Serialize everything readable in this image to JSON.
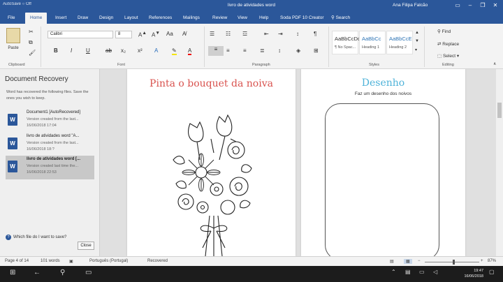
{
  "titlebar": {
    "quick_access": "AutoSave ○ Off",
    "title": "livro de atividades word",
    "user": "Ana Filipa Falcão"
  },
  "tabs": [
    "File",
    "Home",
    "Insert",
    "Draw",
    "Design",
    "Layout",
    "References",
    "Mailings",
    "Review",
    "View",
    "Help",
    "Soda PDF 10 Creator",
    "Search"
  ],
  "ribbon": {
    "clipboard_label": "Clipboard",
    "paste_label": "Paste",
    "font_name": "Calibri",
    "font_size": "8",
    "font_label": "Font",
    "paragraph_label": "Paragraph",
    "styles_label": "Styles",
    "editing_label": "Editing",
    "styles": [
      {
        "sample": "AaBbCcDc",
        "name": "¶ No Spac..."
      },
      {
        "sample": "AaBbCc",
        "name": "Heading 1"
      },
      {
        "sample": "AaBbCcE",
        "name": "Heading 2"
      }
    ],
    "find": "Find",
    "replace": "Replace",
    "select": "Select"
  },
  "recovery": {
    "title": "Document Recovery",
    "description": "Word has recovered the following files. Save the ones you wish to keep.",
    "items": [
      {
        "name": "Document1 [AutoRecovered]",
        "info": "Version created from the last...",
        "date": "16/06/2018 17:04"
      },
      {
        "name": "livro de atividades word \"A...",
        "info": "Version created from the last...",
        "date": "16/06/2018 18:?"
      },
      {
        "name": "livro de atividades word [...",
        "info": "Version created last time the...",
        "date": "16/06/2018 22:53"
      }
    ],
    "help_text": "Which file do I want to save?",
    "close": "Close"
  },
  "document": {
    "page1_title": "Pinta o bouquet da noiva",
    "page2_title": "Desenho",
    "page2_subtitle": "Faz um desenho dos noivos"
  },
  "statusbar": {
    "page": "Page 4 of 14",
    "words": "101 words",
    "language": "Português (Portugal)",
    "recovered": "Recovered",
    "zoom": "87%"
  },
  "taskbar": {
    "time": "19:47",
    "date": "16/06/2018"
  }
}
